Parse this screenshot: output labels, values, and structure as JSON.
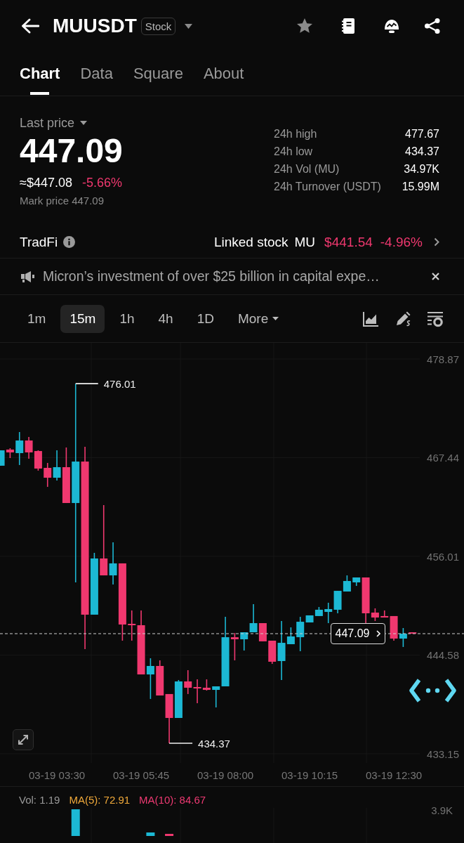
{
  "header": {
    "title": "MUUSDT",
    "badge": "Stock",
    "favorite": false
  },
  "tabs": [
    {
      "label": "Chart",
      "selected": true
    },
    {
      "label": "Data",
      "selected": false
    },
    {
      "label": "Square",
      "selected": false
    },
    {
      "label": "About",
      "selected": false
    }
  ],
  "price": {
    "label": "Last price",
    "last": "447.09",
    "usd": "≈$447.08",
    "change": "-5.66%",
    "mark": "Mark price 447.09"
  },
  "stats": [
    {
      "label": "24h high",
      "value": "477.67"
    },
    {
      "label": "24h low",
      "value": "434.37"
    },
    {
      "label": "24h Vol (MU)",
      "value": "34.97K"
    },
    {
      "label": "24h Turnover (USDT)",
      "value": "15.99M"
    }
  ],
  "tradfi": {
    "label": "TradFi",
    "linked_label": "Linked stock",
    "symbol": "MU",
    "price": "$441.54",
    "change": "-4.96%"
  },
  "news": {
    "text": "Micron’s investment of over $25 billion in capital expe…"
  },
  "intervals": [
    {
      "label": "1m",
      "selected": false
    },
    {
      "label": "15m",
      "selected": true
    },
    {
      "label": "1h",
      "selected": false
    },
    {
      "label": "4h",
      "selected": false
    },
    {
      "label": "1D",
      "selected": false
    }
  ],
  "more": {
    "label": "More"
  },
  "chart": {
    "chart_data": {
      "type": "candlestick",
      "categories": [
        null,
        null,
        null,
        null,
        null,
        null,
        "03-19 03:30",
        null,
        null,
        null,
        null,
        null,
        null,
        null,
        null,
        "03-19 05:45",
        null,
        null,
        null,
        null,
        null,
        null,
        null,
        null,
        "03-19 08:00",
        null,
        null,
        null,
        null,
        null,
        null,
        null,
        null,
        "03-19 10:15",
        null,
        null,
        null,
        null,
        null,
        null,
        null,
        null,
        "03-19 12:30",
        null,
        null
      ],
      "ohlc": [
        [
          466.51,
          468.29,
          466.51,
          468.29
        ],
        [
          468.38,
          468.54,
          467.4,
          468.05
        ],
        [
          467.97,
          470.41,
          466.59,
          469.43
        ],
        [
          469.43,
          469.84,
          467.32,
          468.05
        ],
        [
          468.21,
          468.29,
          465.94,
          466.18
        ],
        [
          466.26,
          466.83,
          464.06,
          465.12
        ],
        [
          465.12,
          468.29,
          464.8,
          466.34
        ],
        [
          466.34,
          468.62,
          462.19,
          462.19
        ],
        [
          462.19,
          476.01,
          453,
          466.99
        ],
        [
          466.99,
          468.7,
          445.27,
          449.26
        ],
        [
          449.26,
          456.42,
          449.26,
          455.77
        ],
        [
          455.77,
          461.95,
          453.81,
          453.81
        ],
        [
          453.81,
          457.64,
          452.76,
          455.2
        ],
        [
          455.2,
          455.2,
          446.25,
          448.12
        ],
        [
          448.2,
          449.75,
          446.25,
          448.04
        ],
        [
          448.04,
          449.75,
          442.34,
          442.34
        ],
        [
          442.34,
          444.21,
          439.5,
          443.32
        ],
        [
          443.32,
          443.97,
          439.9,
          439.9
        ],
        [
          440.07,
          440.07,
          434.37,
          437.3
        ],
        [
          437.3,
          441.69,
          437.3,
          441.53
        ],
        [
          441.53,
          442.83,
          440.07,
          440.8
        ],
        [
          440.88,
          441.77,
          439.01,
          440.72
        ],
        [
          440.8,
          441.77,
          440.47,
          440.55
        ],
        [
          440.55,
          440.96,
          438.52,
          440.96
        ],
        [
          440.96,
          449.01,
          440.96,
          446.65
        ],
        [
          446.65,
          447.14,
          443.97,
          446.41
        ],
        [
          446.41,
          447.22,
          445.11,
          447.22
        ],
        [
          447.22,
          450.48,
          447.22,
          448.28
        ],
        [
          448.28,
          448.28,
          446.17,
          446.17
        ],
        [
          446.25,
          446.25,
          443.56,
          443.81
        ],
        [
          443.89,
          448.53,
          441.69,
          446
        ],
        [
          445.84,
          447.79,
          445.84,
          446.74
        ],
        [
          446.65,
          449.01,
          445.03,
          448.44
        ],
        [
          448.36,
          449.18,
          448.36,
          449.18
        ],
        [
          449.1,
          450.15,
          449.1,
          449.83
        ],
        [
          449.58,
          450.64,
          448.28,
          449.91
        ],
        [
          449.83,
          452.02,
          449.42,
          452.02
        ],
        [
          451.94,
          453.81,
          451.94,
          453.16
        ],
        [
          453,
          453.57,
          452.59,
          453.57
        ],
        [
          453.57,
          453.57,
          448.28,
          449.42
        ],
        [
          449.5,
          449.99,
          448.53,
          448.93
        ],
        [
          449.1,
          449.75,
          448.93,
          448.93
        ],
        [
          449.1,
          449.1,
          446.25,
          446.49
        ],
        [
          446.49,
          447.71,
          445.52,
          447.06
        ],
        [
          447.22,
          447.22,
          447.09,
          447.09
        ]
      ],
      "ylim": [
        433.15,
        478.87
      ],
      "yticks": [
        {
          "value": 478.87,
          "label": "478.87"
        },
        {
          "value": 467.44,
          "label": "467.44"
        },
        {
          "value": 456.01,
          "label": "456.01"
        },
        {
          "value": 444.58,
          "label": "444.58"
        },
        {
          "value": 433.15,
          "label": "433.15"
        }
      ]
    },
    "high_label": "476.01",
    "low_label": "434.37",
    "price_tag": "447.09"
  },
  "volume": {
    "legend": [
      {
        "text": "Vol: 1.19",
        "color": "#9a9a9a"
      },
      {
        "text": "MA(5): 72.91",
        "color": "#f0a93a"
      },
      {
        "text": "MA(10): 84.67",
        "color": "#ef3a73"
      }
    ],
    "axis_label": "3.9K"
  }
}
